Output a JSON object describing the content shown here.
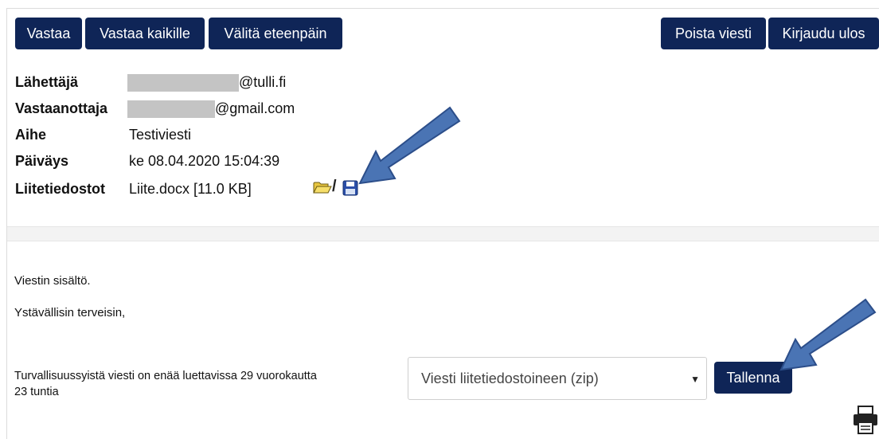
{
  "toolbar": {
    "reply": "Vastaa",
    "reply_all": "Vastaa kaikille",
    "forward": "Välitä eteenpäin",
    "delete": "Poista viesti",
    "logout": "Kirjaudu ulos"
  },
  "header": {
    "sender_label": "Lähettäjä",
    "sender_domain": "@tulli.fi",
    "recipient_label": "Vastaanottaja",
    "recipient_domain": "@gmail.com",
    "subject_label": "Aihe",
    "subject": "Testiviesti",
    "date_label": "Päiväys",
    "date": "ke 08.04.2020 15:04:39",
    "attachments_label": "Liitetiedostot",
    "attachment": "Liite.docx [11.0 KB]",
    "attachment_icons": [
      "open-folder-icon",
      "save-disk-icon"
    ],
    "icon_separator": "/"
  },
  "message": {
    "line1": "Viestin sisältö.",
    "line2": "Ystävällisin terveisin,"
  },
  "footer": {
    "notice_line1": "Turvallisuussyistä viesti on enää luettavissa 29 vuorokautta",
    "notice_line2": "23 tuntia",
    "download_select_value": "Viesti liitetiedostoineen (zip)",
    "save_button": "Tallenna"
  },
  "colors": {
    "button_bg": "#0f2557",
    "arrow_fill": "#4a74b4"
  },
  "icons": [
    "printer-icon"
  ]
}
